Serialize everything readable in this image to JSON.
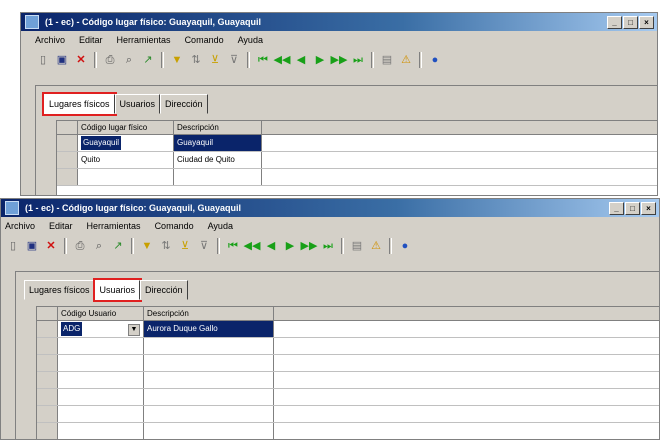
{
  "window1": {
    "title": "(1 - ec) - Código lugar físico: Guayaquil, Guayaquil",
    "menu": [
      "Archivo",
      "Editar",
      "Herramientas",
      "Comando",
      "Ayuda"
    ],
    "tabs": [
      "Lugares físicos",
      "Usuarios",
      "Dirección"
    ],
    "active_tab": "Lugares físicos",
    "grid": {
      "headers": [
        "Código lugar físico",
        "Descripción"
      ],
      "rows": [
        [
          "Guayaquil",
          "Guayaquil"
        ],
        [
          "Quito",
          "Ciudad de Quito"
        ],
        [
          "",
          ""
        ]
      ]
    }
  },
  "window2": {
    "title": "(1 - ec) - Código lugar físico: Guayaquil, Guayaquil",
    "menu": [
      "Archivo",
      "Editar",
      "Herramientas",
      "Comando",
      "Ayuda"
    ],
    "tabs": [
      "Lugares físicos",
      "Usuarios",
      "Dirección"
    ],
    "active_tab": "Usuarios",
    "grid": {
      "headers": [
        "Código Usuario",
        "Descripción"
      ],
      "rows": [
        [
          "ADG",
          "Aurora Duque Gallo"
        ],
        [
          "",
          ""
        ],
        [
          "",
          ""
        ],
        [
          "",
          ""
        ],
        [
          "",
          ""
        ],
        [
          "",
          ""
        ],
        [
          "",
          ""
        ]
      ]
    }
  },
  "toolbar_icons": [
    "new-icon",
    "save-icon",
    "delete-icon",
    "print-icon",
    "print-preview-icon",
    "export-icon",
    "filter-icon",
    "sort-icon",
    "filter-apply-icon",
    "filter-clear-icon",
    "first-record-icon",
    "prev-page-icon",
    "prev-record-icon",
    "next-record-icon",
    "next-page-icon",
    "last-record-icon",
    "notes-icon",
    "alert-icon",
    "help-icon"
  ],
  "colors": {
    "highlight_outline": "#e02020",
    "selection": "#0a246a",
    "titlebar": "#0a246a"
  }
}
